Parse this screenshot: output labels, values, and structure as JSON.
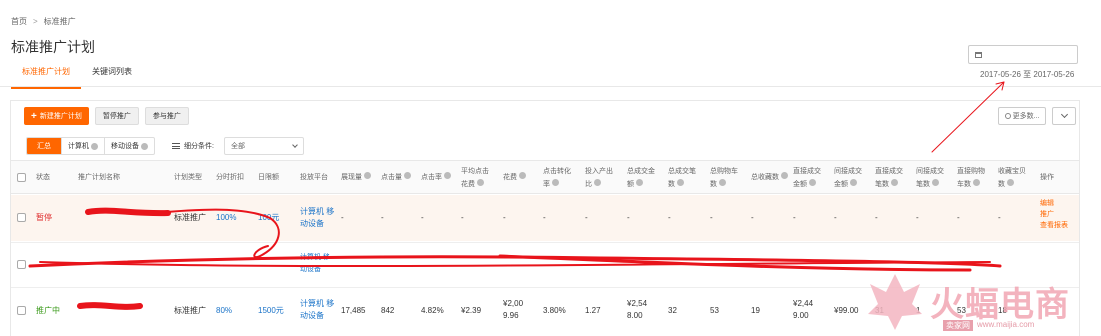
{
  "breadcrumb": [
    "首页",
    "标准推广"
  ],
  "breadcrumb_sep": ">",
  "page_title": "标准推广计划",
  "tabs": [
    {
      "label": "标准推广计划",
      "active": true
    },
    {
      "label": "关键词列表",
      "active": false
    }
  ],
  "date_range": "2017-05-26 至 2017-05-26",
  "toolbar": {
    "new_plan": "新建推广计划",
    "pause": "暂停推广",
    "join": "参与推广",
    "more": "更多数..."
  },
  "segments": {
    "summary": "汇总",
    "pc": "计算机",
    "mobile": "移动设备"
  },
  "filter": {
    "label": "细分条件:",
    "value": "全部"
  },
  "headers": {
    "status": "状态",
    "name": "推广计划名称",
    "plan_type": "计划类型",
    "time_discount": "分时折扣",
    "daily_limit": "日限额",
    "platform": "投放平台",
    "impressions": "展现量",
    "clicks": "点击量",
    "ctr": "点击率",
    "avg_cpc_1": "平均点击",
    "avg_cpc_2": "花费",
    "cost": "花费",
    "cvr_1": "点击转化",
    "cvr_2": "率",
    "roi_1": "投入产出",
    "roi_2": "比",
    "gmv_1": "总成交金",
    "gmv_2": "额",
    "orders": "总成交笔数",
    "orders_1": "总成交笔",
    "orders_2": "数",
    "carts_1": "总购物车",
    "carts_2": "数",
    "favs": "总收藏数",
    "direct_gmv_1": "直接成交",
    "direct_gmv_2": "金额",
    "indirect_gmv_1": "间接成交",
    "indirect_gmv_2": "金额",
    "direct_orders_1": "直接成交",
    "direct_orders_2": "笔数",
    "indirect_orders_1": "间接成交",
    "indirect_orders_2": "笔数",
    "direct_carts_1": "直接购物",
    "direct_carts_2": "车数",
    "fav_items_1": "收藏宝贝",
    "fav_items_2": "数",
    "ops": "操作"
  },
  "rows": [
    {
      "status": "暂停",
      "plan_type": "标准推广",
      "time_discount": "100%",
      "daily_limit": "100元",
      "platform_1": "计算机 移",
      "platform_2": "动设备",
      "impressions": "-",
      "clicks": "-",
      "ctr": "-",
      "avg_cpc": "-",
      "cost": "-",
      "cvr": "-",
      "roi": "-",
      "gmv": "-",
      "orders": "-",
      "carts": "-",
      "favs": "-",
      "direct_gmv": "-",
      "indirect_gmv": "-",
      "direct_orders": "-",
      "indirect_orders": "-",
      "direct_carts": "-",
      "fav_items": "-",
      "op_edit": "编辑",
      "op_promo": "推广",
      "op_report": "查看报表"
    },
    {
      "status": "推广中",
      "plan_type": "标准推广",
      "time_discount": "80%",
      "daily_limit": "1500元",
      "platform_1": "计算机 移",
      "platform_2": "动设备",
      "impressions": "17,485",
      "clicks": "842",
      "ctr": "4.82%",
      "avg_cpc": "¥2.39",
      "cost_1": "¥2,00",
      "cost_2": "9.96",
      "cvr": "3.80%",
      "roi": "1.27",
      "gmv_1": "¥2,54",
      "gmv_2": "8.00",
      "orders": "32",
      "carts": "53",
      "favs": "19",
      "direct_gmv_1": "¥2,44",
      "direct_gmv_2": "9.00",
      "indirect_gmv": "¥99.00",
      "direct_orders": "31",
      "indirect_orders": "1",
      "direct_carts": "53",
      "fav_items": "18"
    }
  ],
  "row2_partial": {
    "platform_1": "计算机 移",
    "platform_2": "动设备"
  },
  "watermark": {
    "text": "火蝠电商",
    "sub_1": "卖家网",
    "sub_2": "www.maijia.com"
  },
  "colors": {
    "accent": "#ff6600",
    "link": "#1a73c8",
    "paused": "#e03030",
    "active": "#3a9a1a",
    "scribble": "#e8141b"
  }
}
